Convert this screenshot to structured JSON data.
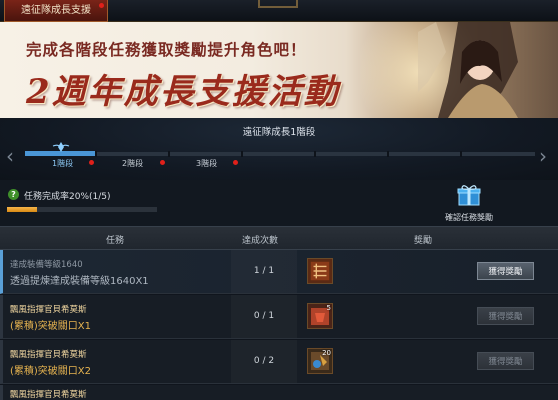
{
  "tab": {
    "active_label": "遠征隊成長支援"
  },
  "banner": {
    "subtitle": "完成各階段任務獲取獎勵提升角色吧！",
    "title": "2週年成長支援活動"
  },
  "stage": {
    "title": "遠征隊成長1階段",
    "steps": [
      {
        "label": "1階段",
        "active": true
      },
      {
        "label": "2階段",
        "active": false
      },
      {
        "label": "3階段",
        "active": false
      }
    ]
  },
  "completion": {
    "text": "任務完成率20%(1/5)",
    "progress": 0.2
  },
  "reward_check": {
    "label": "確認任務獎勵"
  },
  "table": {
    "headers": {
      "task": "任務",
      "count": "達成次數",
      "reward": "獎勵"
    },
    "rows": [
      {
        "line1": "達成裝備等級1640",
        "line2": "透過提煉達成裝備等級1640X1",
        "count": "1 / 1",
        "qty": "",
        "button": "獲得獎勵",
        "enabled": true
      },
      {
        "line1": "飄風指揮官貝希莫斯",
        "line2": "(累積)突破關口X1",
        "count": "0 / 1",
        "qty": "5",
        "button": "獲得獎勵",
        "enabled": false
      },
      {
        "line1": "飄風指揮官貝希莫斯",
        "line2": "(累積)突破關口X2",
        "count": "0 / 2",
        "qty": "20",
        "button": "獲得獎勵",
        "enabled": false
      },
      {
        "line1": "飄風指揮官貝希莫斯",
        "line2": "",
        "count": "",
        "qty": "",
        "button": "",
        "enabled": false
      }
    ]
  },
  "colors": {
    "accent": "#4a96d6",
    "progress": "#f0a52e",
    "alert": "#e0201a"
  }
}
